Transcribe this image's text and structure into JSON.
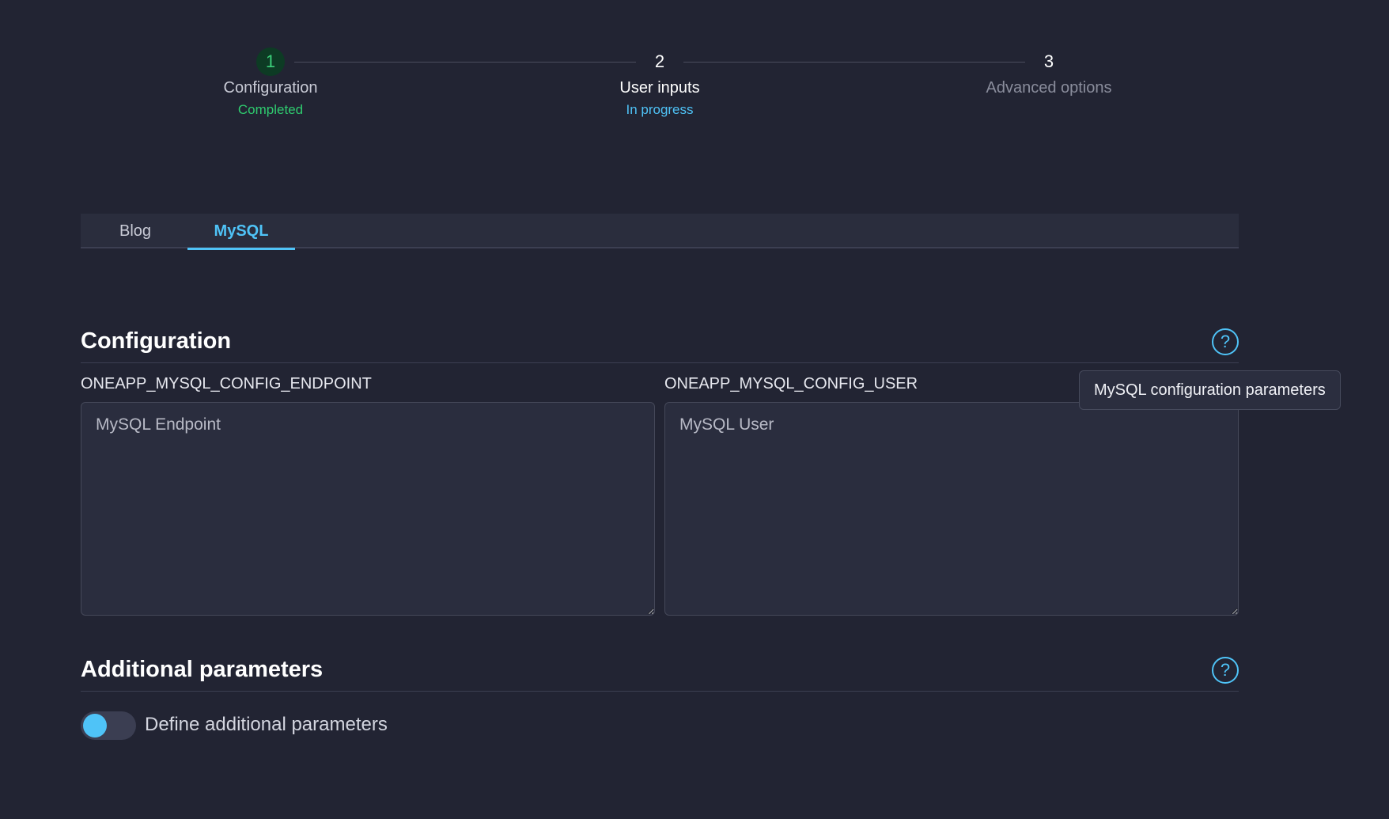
{
  "stepper": {
    "steps": [
      {
        "number": "1",
        "title": "Configuration",
        "status": "Completed"
      },
      {
        "number": "2",
        "title": "User inputs",
        "status": "In progress"
      },
      {
        "number": "3",
        "title": "Advanced options",
        "status": ""
      }
    ]
  },
  "tabs": [
    {
      "label": "Blog",
      "active": false
    },
    {
      "label": "MySQL",
      "active": true
    }
  ],
  "configuration": {
    "title": "Configuration",
    "help": "?",
    "tooltip": "MySQL configuration parameters",
    "fields": [
      {
        "label": "ONEAPP_MYSQL_CONFIG_ENDPOINT",
        "placeholder": "MySQL Endpoint",
        "value": ""
      },
      {
        "label": "ONEAPP_MYSQL_CONFIG_USER",
        "placeholder": "MySQL User",
        "value": ""
      }
    ]
  },
  "additional": {
    "title": "Additional parameters",
    "help": "?",
    "toggle_label": "Define additional parameters",
    "toggle_on": false
  },
  "colors": {
    "background": "#222433",
    "accent": "#4fc3f7",
    "completed": "#2fcb6f"
  }
}
